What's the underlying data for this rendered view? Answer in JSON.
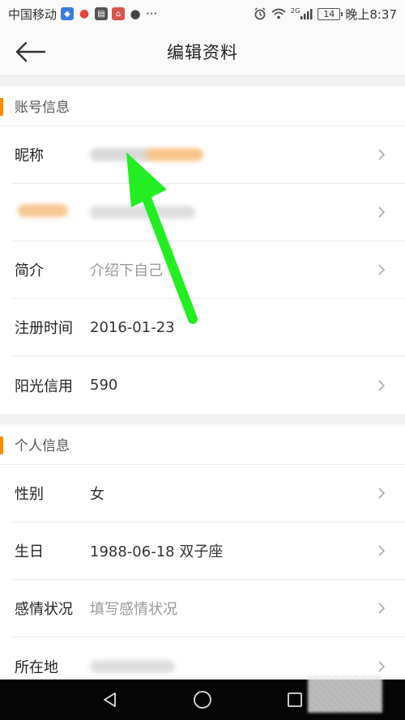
{
  "status_bar": {
    "carrier": "中国移动",
    "time": "晚上8:37",
    "battery": "14",
    "signal": "2G",
    "more": "···"
  },
  "header": {
    "title": "编辑资料"
  },
  "account_section": {
    "title": "账号信息",
    "rows": {
      "nickname": {
        "label": "昵称"
      },
      "intro": {
        "label": "简介",
        "placeholder": "介绍下自己"
      },
      "register": {
        "label": "注册时间",
        "value": "2016-01-23"
      },
      "credit": {
        "label": "阳光信用",
        "value": "590"
      }
    }
  },
  "personal_section": {
    "title": "个人信息",
    "rows": {
      "gender": {
        "label": "性别",
        "value": "女"
      },
      "birthday": {
        "label": "生日",
        "value": "1988-06-18 双子座"
      },
      "relationship": {
        "label": "感情状况",
        "placeholder": "填写感情状况"
      },
      "location": {
        "label": "所在地"
      }
    }
  },
  "colors": {
    "accent": "#ff8a00",
    "annotation_arrow": "#22ee22"
  }
}
